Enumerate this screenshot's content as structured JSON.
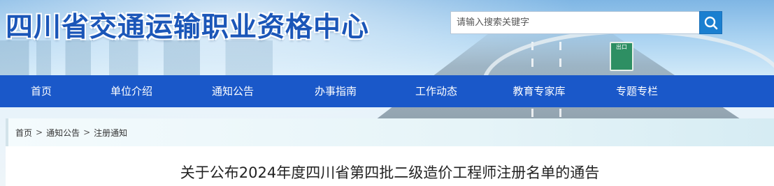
{
  "header": {
    "site_title": "四川省交通运输职业资格中心",
    "road_sign_text": "出口"
  },
  "search": {
    "placeholder": "请输入搜索关键字",
    "button_icon": "search-icon"
  },
  "nav": {
    "items": [
      {
        "label": "首页"
      },
      {
        "label": "单位介绍"
      },
      {
        "label": "通知公告"
      },
      {
        "label": "办事指南"
      },
      {
        "label": "工作动态"
      },
      {
        "label": "教育专家库"
      },
      {
        "label": "专题专栏"
      }
    ]
  },
  "breadcrumb": {
    "items": [
      "首页",
      "通知公告",
      "注册通知"
    ],
    "separator": ">"
  },
  "article": {
    "title": "关于公布2024年度四川省第四批二级造价工程师注册名单的通告"
  },
  "colors": {
    "nav_bg": "#1a58c9",
    "title_blue": "#1b56b8",
    "search_button": "#1a7fd0"
  }
}
